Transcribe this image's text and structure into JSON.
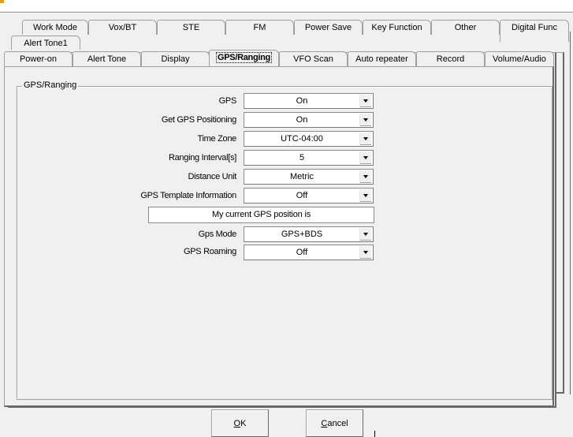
{
  "window": {
    "title": ""
  },
  "tabs_row1": [
    {
      "label": "Work Mode"
    },
    {
      "label": "Vox/BT"
    },
    {
      "label": "STE"
    },
    {
      "label": "FM"
    },
    {
      "label": "Power Save"
    },
    {
      "label": "Key Function"
    },
    {
      "label": "Other"
    },
    {
      "label": "Digital Func"
    }
  ],
  "tabs_row2": [
    {
      "label": "Alert Tone1"
    }
  ],
  "tabs_row3": [
    {
      "label": "Power-on"
    },
    {
      "label": "Alert Tone"
    },
    {
      "label": "Display"
    },
    {
      "label": "GPS/Ranging",
      "active": true
    },
    {
      "label": "VFO Scan"
    },
    {
      "label": "Auto repeater"
    },
    {
      "label": "Record"
    },
    {
      "label": "Volume/Audio"
    }
  ],
  "group": {
    "label": "GPS/Ranging"
  },
  "fields": [
    {
      "label": "GPS",
      "value": "On"
    },
    {
      "label": "Get GPS Positioning",
      "value": "On"
    },
    {
      "label": "Time Zone",
      "value": "UTC-04:00"
    },
    {
      "label": "Ranging Interval[s]",
      "value": "5"
    },
    {
      "label": "Distance Unit",
      "value": "Metric"
    },
    {
      "label": "GPS Template Information",
      "value": "Off"
    },
    {
      "label": "Gps Mode",
      "value": "GPS+BDS"
    },
    {
      "label": "GPS Roaming",
      "value": "Off"
    }
  ],
  "template_text": "My current GPS position is",
  "buttons": {
    "ok": {
      "mnemonic": "O",
      "rest": "K"
    },
    "cancel": {
      "mnemonic": "C",
      "rest": "ancel"
    }
  }
}
